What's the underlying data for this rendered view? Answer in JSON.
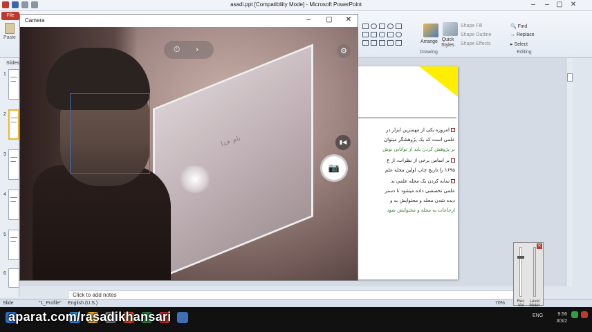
{
  "window": {
    "title": "asadi.ppt [Compatibility Mode] - Microsoft PowerPoint",
    "minimize": "–",
    "maximize": "▢",
    "close": "✕"
  },
  "ribbon": {
    "file_tab": "File",
    "paste_label": "Paste",
    "drawing_group": "Drawing",
    "editing_group": "Editing",
    "arrange_label": "Arrange",
    "quick_styles_label": "Quick\nStyles",
    "shape_fill": "Shape Fill",
    "shape_outline": "Shape Outline",
    "shape_effects": "Shape Effects",
    "find": "Find",
    "replace": "Replace",
    "select": "Select"
  },
  "slides_panel": {
    "tab_label": "Slides",
    "numbers": [
      "1",
      "2",
      "3",
      "4",
      "5",
      "6"
    ]
  },
  "slide": {
    "lines": [
      {
        "text": "امروزه یکی از مهمترین ابزار در",
        "bullet": true,
        "color": "default"
      },
      {
        "text": "علمی است که یک پژوهشگر میتوان",
        "bullet": false,
        "color": "default"
      },
      {
        "text": "بر پژوهش کردن باید از توانایی نوش",
        "bullet": false,
        "color": "mixed"
      },
      {
        "text": "بر اساس برخی از نظرات، از ع",
        "bullet": true,
        "color": "default"
      },
      {
        "text": "۱۶۹۵ را تاریخ چاپ اولین مجله علم",
        "bullet": false,
        "color": "default"
      },
      {
        "text": "نمایه کردن یک مجله علمی بد",
        "bullet": true,
        "color": "default"
      },
      {
        "text": "علمی تخصصی داده میشود تا دستر",
        "bullet": false,
        "color": "default"
      },
      {
        "text": "دیده شدن مجله و محتوایش به و",
        "bullet": false,
        "color": "default"
      },
      {
        "text": "ارجاعات به مجله و محتوایش شود",
        "bullet": false,
        "color": "mixed"
      }
    ]
  },
  "notes": {
    "placeholder": "Click to add notes"
  },
  "statusbar": {
    "slide_info": "Slide",
    "theme": "\"1_Profile\"",
    "language": "English (U.S.)",
    "zoom": "70%"
  },
  "camera": {
    "title": "Camera",
    "board_text": "نام خدا"
  },
  "meter": {
    "rec_label": "Rec\nVol",
    "level_label": "Level\nMeter"
  },
  "taskbar": {
    "lang": "ENG",
    "time": "9:56",
    "date": "3/3/2"
  },
  "watermark": "aparat.com/rasadikhansari",
  "colors": {
    "file_tab": "#c0392b",
    "slide_corner": "#ffee00",
    "face_box": "#3d6fb4",
    "bullet": "#8b1a1a"
  }
}
